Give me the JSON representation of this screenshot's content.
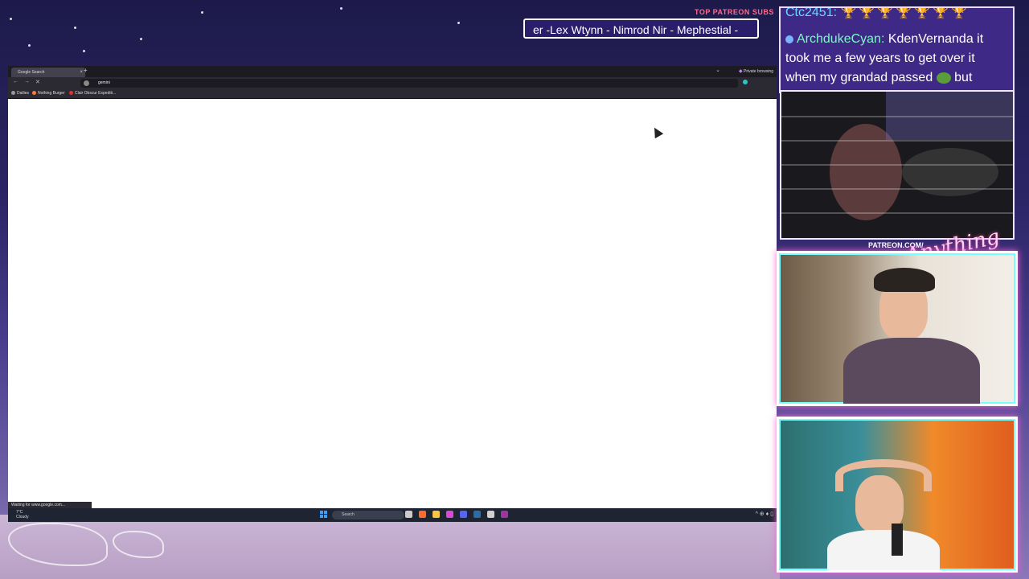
{
  "overlay": {
    "top_patreon_title": "TOP PATREON SUBS",
    "patreon_subs_ticker": "er -Lex Wtynn - Nimrod Nir - Mephestial -",
    "patreon_url_label": "PATREON.COM/",
    "patreon_brand": "Anything Else"
  },
  "chat": {
    "line1_user": "Ctc2451:",
    "line1_badges": "🏆🏆🏆🏆🏆🏆🏆",
    "message_user": "ArchdukeCyan:",
    "message_text": "KdenVernanda it took me a few years to get over it when my grandad passed",
    "message_tail": "but"
  },
  "browser": {
    "tab_title": "Google Search",
    "tab_close": "×",
    "new_tab": "+",
    "list_tabs": "⌄",
    "private_label": "Private browsing",
    "back": "←",
    "forward": "→",
    "stop": "✕",
    "url_text": "gemini",
    "bookmarks": [
      {
        "label": "Dailies"
      },
      {
        "label": "Nothing Burger"
      },
      {
        "label": "Clair Obscur Expediti..."
      }
    ],
    "status_text": "Waiting for www.google.com..."
  },
  "taskbar": {
    "weather_temp": "7°C",
    "weather_desc": "Cloudy",
    "search_label": "Search",
    "tray": "^ ⊕ ♦ ▯"
  }
}
